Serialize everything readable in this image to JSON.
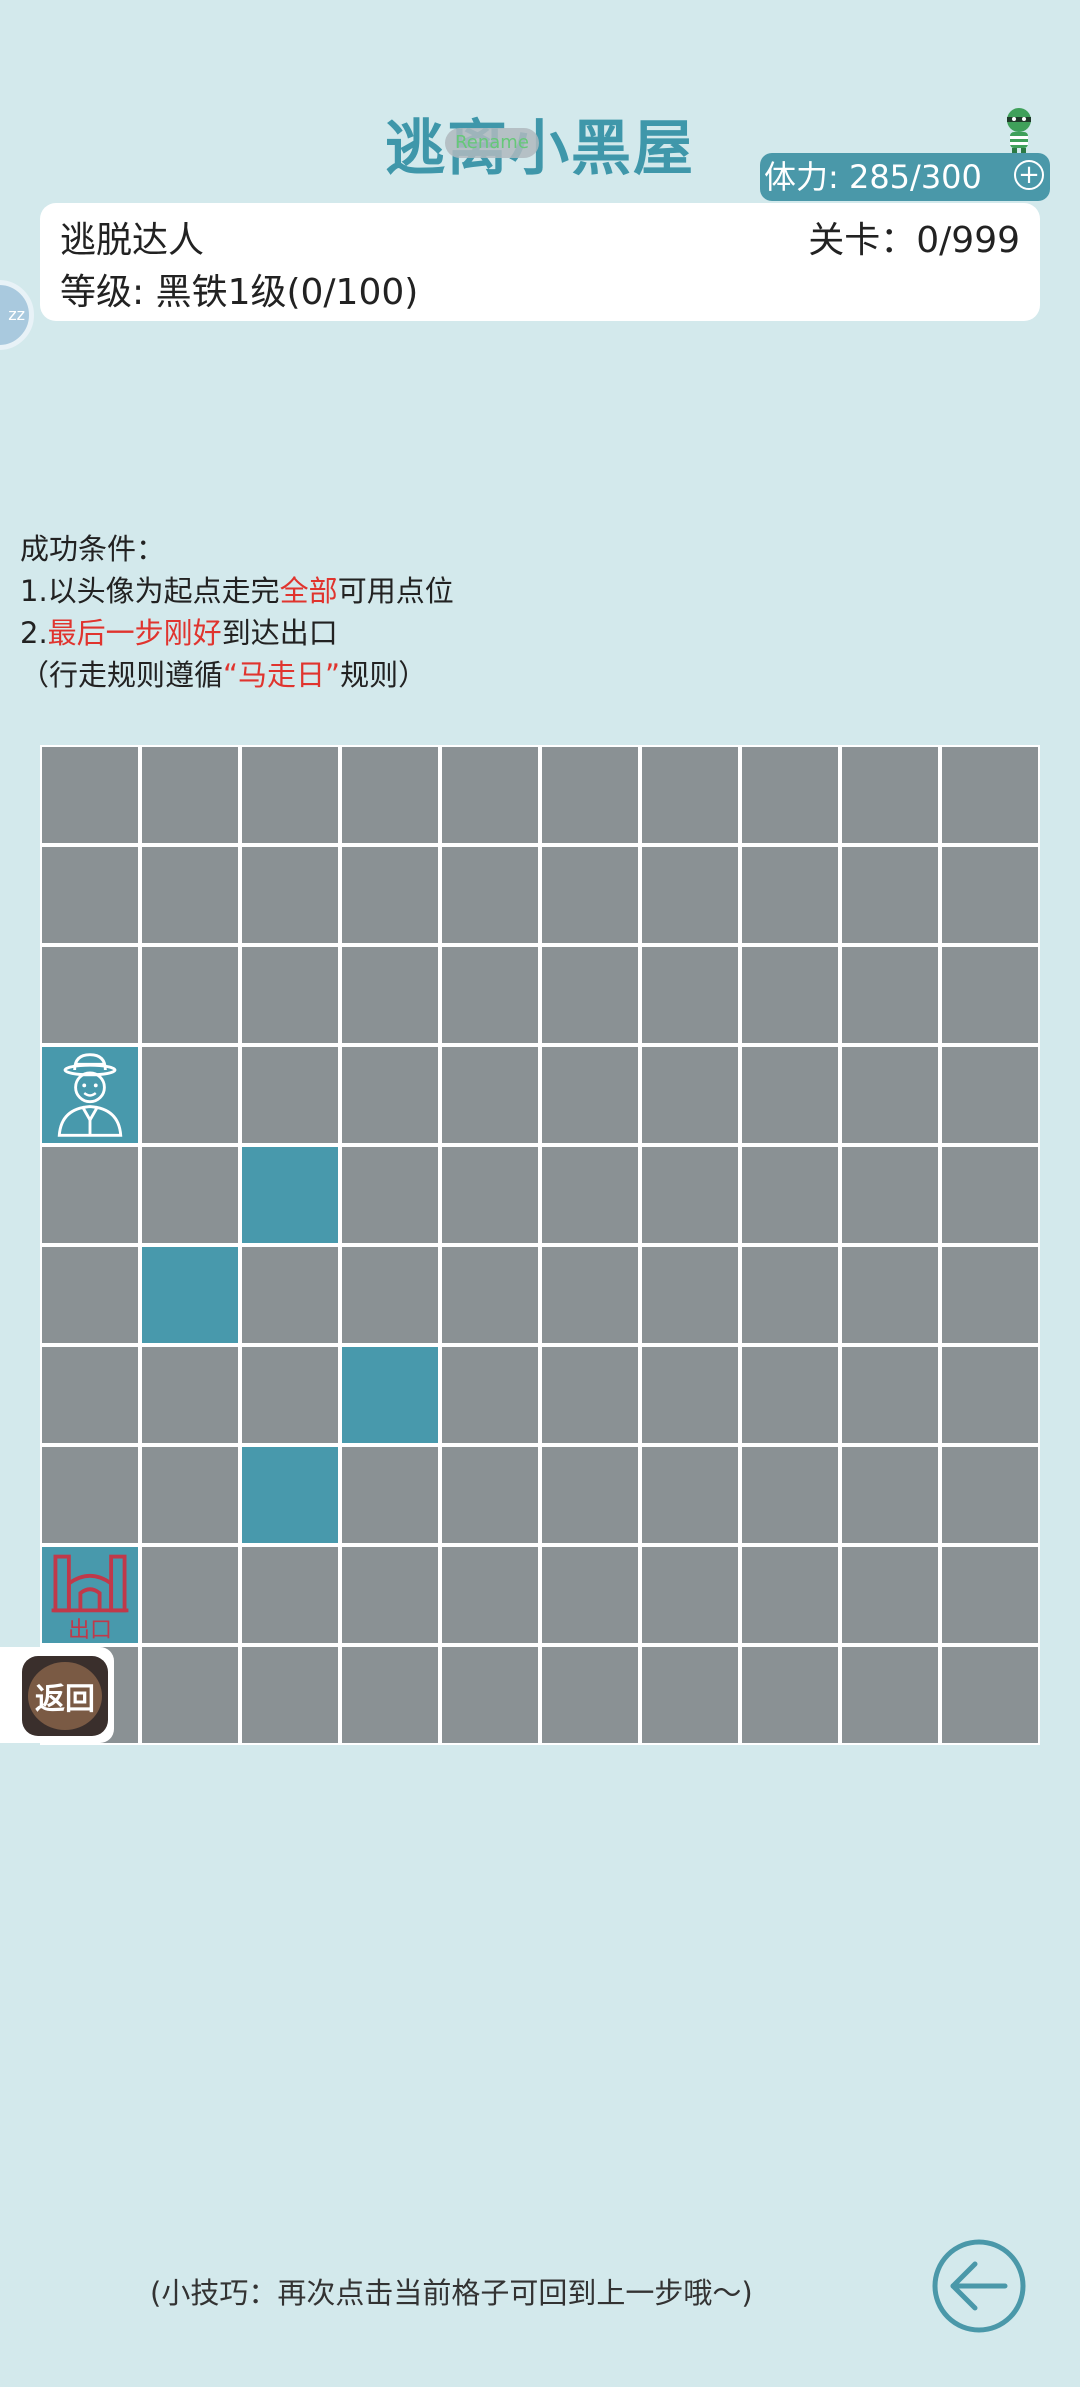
{
  "header": {
    "title": "逃离小黑屋",
    "badge": "Rename",
    "stamina": "体力: 285/300",
    "plus_icon": "plus-circle-icon",
    "avatar_icon": "thief-avatar-icon"
  },
  "player": {
    "name": "逃脱达人",
    "rank": "等级: 黑铁1级(0/100)",
    "level": "关卡：0/999"
  },
  "float_button": "zz",
  "rules": {
    "heading": "成功条件：",
    "line1_prefix": "1.以头像为起点走完",
    "line1_highlight": "全部",
    "line1_suffix": "可用点位",
    "line2_prefix": "2.",
    "line2_highlight": "最后一步刚好",
    "line2_suffix": "到达出口",
    "line3_prefix": "（行走规则遵循",
    "line3_highlight": "“马走日”",
    "line3_suffix": "规则）"
  },
  "board": {
    "rows": 10,
    "cols": 10,
    "start": [
      3,
      0
    ],
    "exit": [
      8,
      0
    ],
    "exit_label": "出口",
    "available_cells": [
      [
        4,
        2
      ],
      [
        5,
        1
      ],
      [
        6,
        3
      ],
      [
        7,
        2
      ]
    ],
    "colors": {
      "blocked": "#8a9194",
      "available": "#4899ac",
      "background": "#d3e9ec"
    }
  },
  "back_button": {
    "label": "返回"
  },
  "tip": "(小技巧：再次点击当前格子可回到上一步哦～)",
  "undo_icon": "undo-arrow-icon"
}
